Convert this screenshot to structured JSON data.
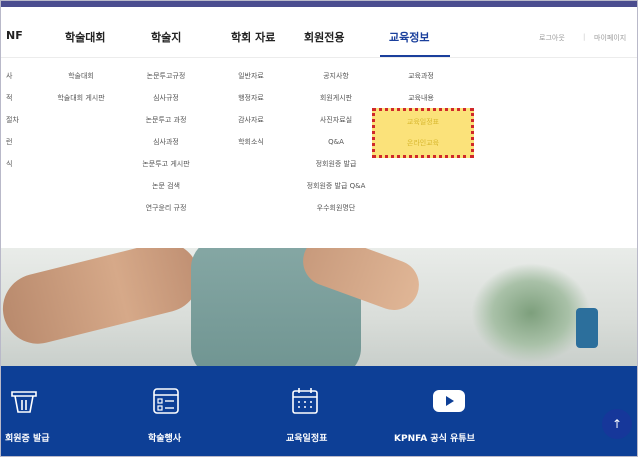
{
  "header": {
    "nav": [
      "NF",
      "학술대회",
      "학술지",
      "학회 자료",
      "회원전용",
      "교육정보"
    ],
    "active_index": 5,
    "utility": {
      "logout": "로그아웃",
      "separator": "|",
      "mypage": "마이페이지"
    }
  },
  "dropdown": {
    "col0": [
      "사",
      "적",
      "절차",
      "런",
      "식"
    ],
    "col1": [
      "학술대회",
      "학술대회 게시판"
    ],
    "col2": [
      "논문투고규정",
      "심사규정",
      "논문투고 과정",
      "심사과정",
      "논문투고 게시판",
      "논문 검색",
      "연구윤리 규정"
    ],
    "col3": [
      "일반자료",
      "행정자료",
      "감사자료",
      "학회소식"
    ],
    "col4": [
      "공지사항",
      "회원게시판",
      "사진자료실",
      "Q&A",
      "정회원증 발급",
      "정회원증 발급 Q&A",
      "우수회원명단"
    ],
    "col5": [
      "교육과정",
      "교육내용"
    ],
    "col5_highlighted": [
      "교육일정표",
      "온라인교육"
    ]
  },
  "quick_menu": {
    "items": [
      {
        "label": "회원증 발급",
        "icon": "card-icon"
      },
      {
        "label": "학술행사",
        "icon": "list-icon"
      },
      {
        "label": "교육일정표",
        "icon": "calendar-icon"
      },
      {
        "label": "KPNFA 공식 유튜브",
        "icon": "youtube-icon"
      }
    ],
    "top_button": "↑"
  },
  "colors": {
    "top_bar": "#4b4d8f",
    "active_nav": "#1a3f9c",
    "quick_bar": "#0d3f96",
    "highlight_fill": "#fbe27a",
    "highlight_border": "#d0282a"
  }
}
